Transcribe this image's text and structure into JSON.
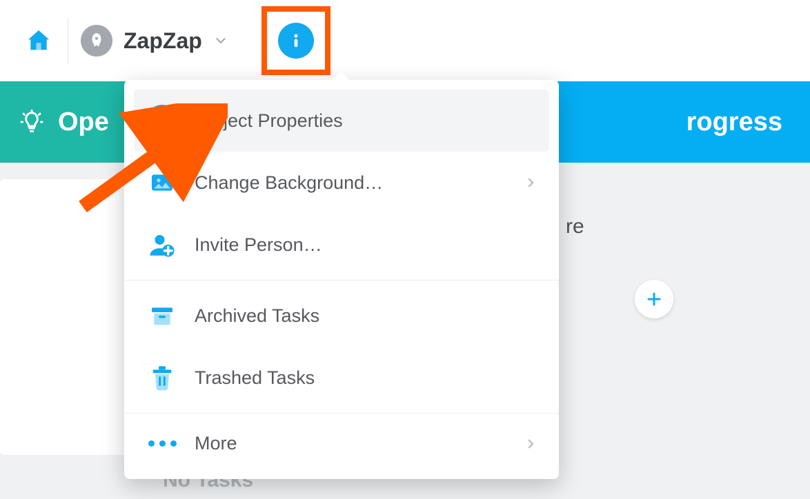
{
  "header": {
    "project_name": "ZapZap"
  },
  "status": {
    "open_label": "Ope",
    "progress_label": "rogress"
  },
  "dropdown": {
    "items": [
      {
        "label": "Project Properties"
      },
      {
        "label": "Change Background…"
      },
      {
        "label": "Invite Person…"
      },
      {
        "label": "Archived Tasks"
      },
      {
        "label": "Trashed Tasks"
      },
      {
        "label": "More"
      }
    ]
  },
  "content": {
    "fragment_text": "re",
    "empty_label": "No Tasks"
  }
}
